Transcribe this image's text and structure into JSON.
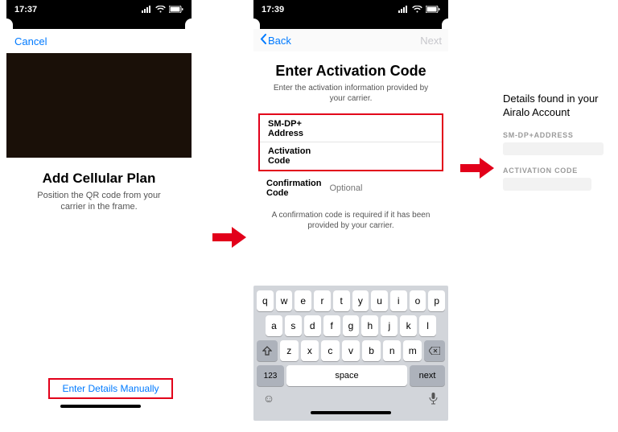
{
  "status": {
    "time1": "17:37",
    "time2": "17:39"
  },
  "phone1": {
    "cancel": "Cancel",
    "title": "Add Cellular Plan",
    "subtitle": "Position the QR code from your carrier in the frame.",
    "manual": "Enter Details Manually"
  },
  "phone2": {
    "back": "Back",
    "next": "Next",
    "title": "Enter Activation Code",
    "subtitle": "Enter the activation information provided by your carrier.",
    "field1": "SM-DP+ Address",
    "field2": "Activation Code",
    "conf_label": "Confirmation Code",
    "conf_placeholder": "Optional",
    "conf_note": "A confirmation code is required if it has been provided by your carrier."
  },
  "keyboard": {
    "row1": [
      "q",
      "w",
      "e",
      "r",
      "t",
      "y",
      "u",
      "i",
      "o",
      "p"
    ],
    "row2": [
      "a",
      "s",
      "d",
      "f",
      "g",
      "h",
      "j",
      "k",
      "l"
    ],
    "row3": [
      "z",
      "x",
      "c",
      "v",
      "b",
      "n",
      "m"
    ],
    "k123": "123",
    "space": "space",
    "next": "next"
  },
  "right": {
    "title": "Details found in your Airalo Account",
    "lbl1": "SM-DP+ADDRESS",
    "lbl2": "ACTIVATION CODE"
  }
}
